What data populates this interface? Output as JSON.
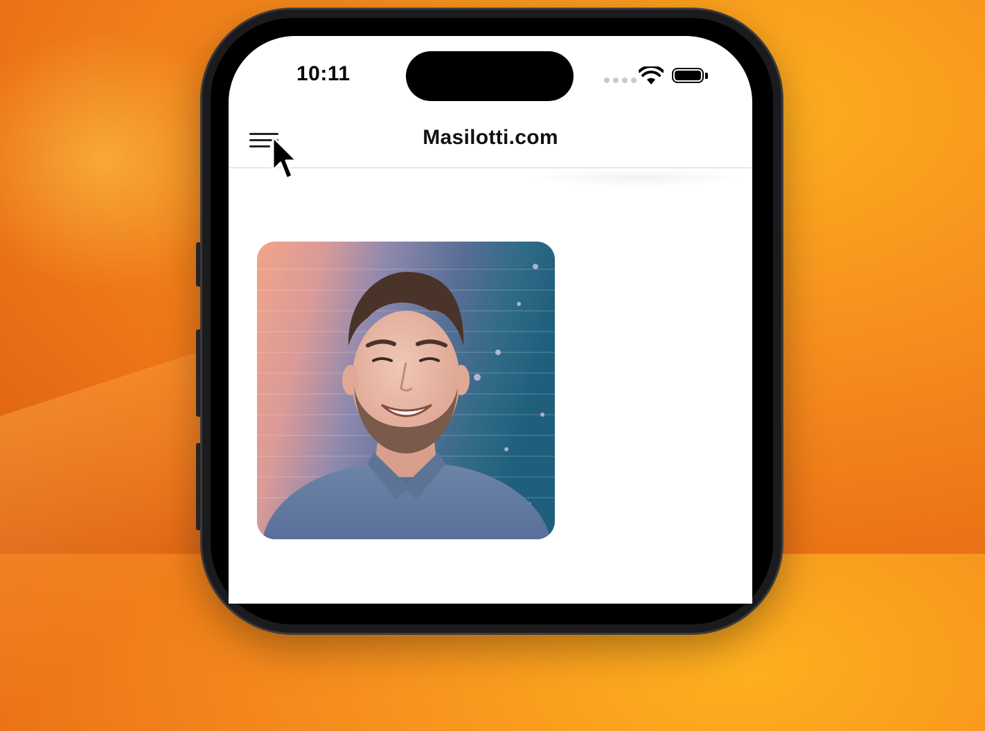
{
  "status_bar": {
    "time": "10:11"
  },
  "nav_bar": {
    "title": "Masilotti.com",
    "menu_icon": "hamburger-menu-icon"
  },
  "content": {
    "profile_photo": "portrait-photo"
  },
  "colors": {
    "wallpaper_orange": "#f7911e",
    "phone_frame": "#1b1b1d",
    "screen_background": "#ffffff"
  }
}
